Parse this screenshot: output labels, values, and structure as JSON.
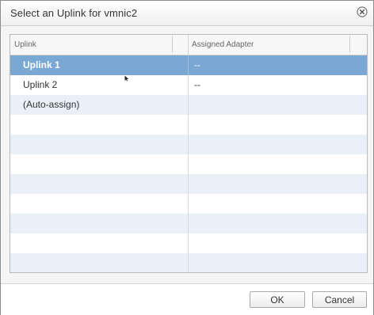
{
  "dialog": {
    "title": "Select an Uplink for vmnic2",
    "close_icon": "close-circle-icon"
  },
  "grid": {
    "columns": [
      "Uplink",
      "Assigned Adapter"
    ],
    "rows": [
      {
        "uplink": "Uplink 1",
        "adapter": "--",
        "selected": true
      },
      {
        "uplink": "Uplink 2",
        "adapter": "--",
        "selected": false
      },
      {
        "uplink": "(Auto-assign)",
        "adapter": "",
        "selected": false
      }
    ],
    "empty_row_count": 8
  },
  "footer": {
    "ok_label": "OK",
    "cancel_label": "Cancel"
  },
  "colors": {
    "selection": "#7aa8d3",
    "alt_row": "#e9f0f8"
  }
}
